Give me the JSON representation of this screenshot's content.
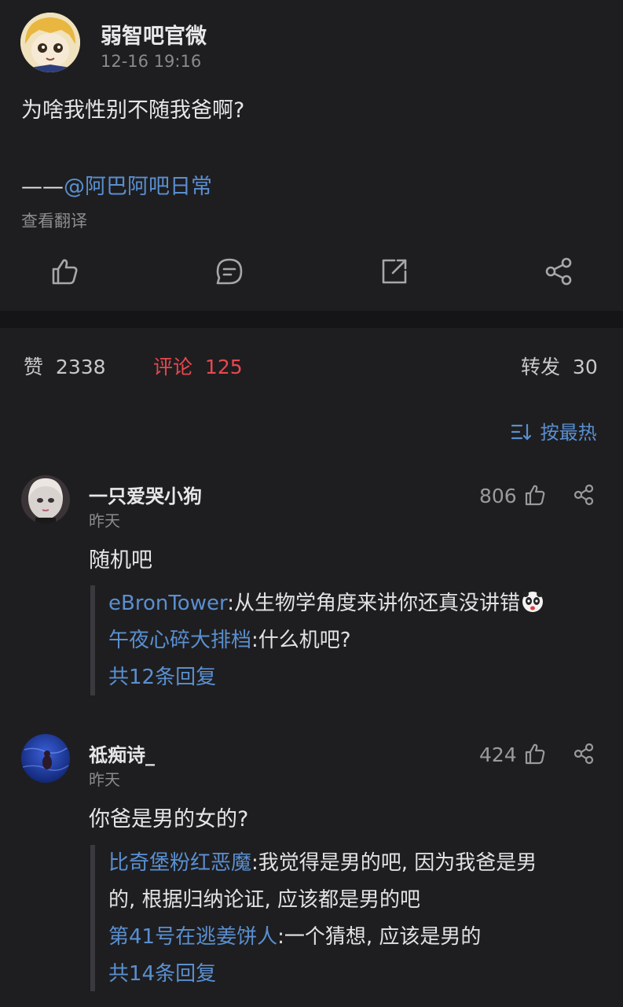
{
  "post": {
    "author": "弱智吧官微",
    "time": "12-16 19:16",
    "text": "为啥我性别不随我爸啊?",
    "credit_prefix": "——",
    "credit_link": "@阿巴阿吧日常",
    "translate": "查看翻译"
  },
  "stats": {
    "likes_label": "赞",
    "likes": "2338",
    "comments_label": "评论",
    "comments": "125",
    "reposts_label": "转发",
    "reposts": "30"
  },
  "sort": {
    "label": "按最热",
    "icon": "sort-icon"
  },
  "comments": [
    {
      "user": "一只爱哭小狗",
      "time": "昨天",
      "likes": "806",
      "text": "随机吧",
      "replies": [
        {
          "user": "eBronTower",
          "sep": ":",
          "text": "从生物学角度来讲你还真没讲错",
          "emoji": "panda-emoji"
        },
        {
          "user": "午夜心碎大排档",
          "sep": ":",
          "text": "什么机吧?"
        }
      ],
      "more": "共12条回复"
    },
    {
      "user": "祗痴诗_",
      "time": "昨天",
      "likes": "424",
      "text": "你爸是男的女的?",
      "replies": [
        {
          "user": "比奇堡粉红恶魔",
          "sep": ":",
          "text": "我觉得是男的吧, 因为我爸是男",
          "text2": "的, 根据归纳论证, 应该都是男的吧"
        },
        {
          "user": "第41号在逃姜饼人",
          "sep": ":",
          "text": "一个猜想, 应该是男的"
        }
      ],
      "more": "共14条回复"
    }
  ],
  "colors": {
    "accent": "#5a8fd0",
    "active": "#e8484e",
    "background": "#1e1e20"
  }
}
